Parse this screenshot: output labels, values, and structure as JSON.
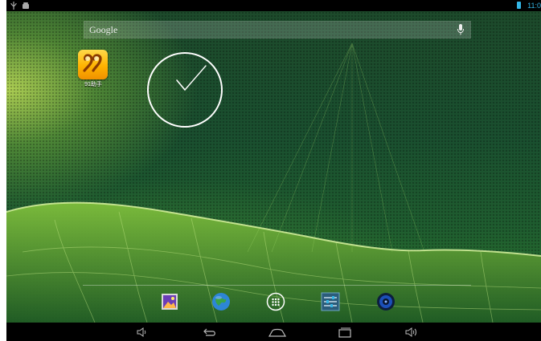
{
  "status_bar": {
    "left_icons": [
      "usb-icon",
      "android-debug-icon"
    ],
    "right_icons": [
      "battery-icon"
    ],
    "time": "11:0",
    "accent": "#33b5e5"
  },
  "search": {
    "label": "Google",
    "icon": "mic-icon"
  },
  "desktop": {
    "apps": [
      {
        "label": "91助手",
        "icon": "91-assistant-icon"
      }
    ],
    "widgets": [
      "analog-clock-widget"
    ]
  },
  "dock": {
    "items": [
      {
        "name": "gallery",
        "icon": "gallery-icon"
      },
      {
        "name": "browser",
        "icon": "globe-icon"
      },
      {
        "name": "all-apps",
        "icon": "all-apps-icon"
      },
      {
        "name": "settings",
        "icon": "settings-icon"
      },
      {
        "name": "music",
        "icon": "music-icon"
      }
    ]
  },
  "nav_bar": {
    "buttons": [
      "volume-down-icon",
      "back-icon",
      "home-icon",
      "recent-apps-icon",
      "volume-up-icon"
    ]
  }
}
